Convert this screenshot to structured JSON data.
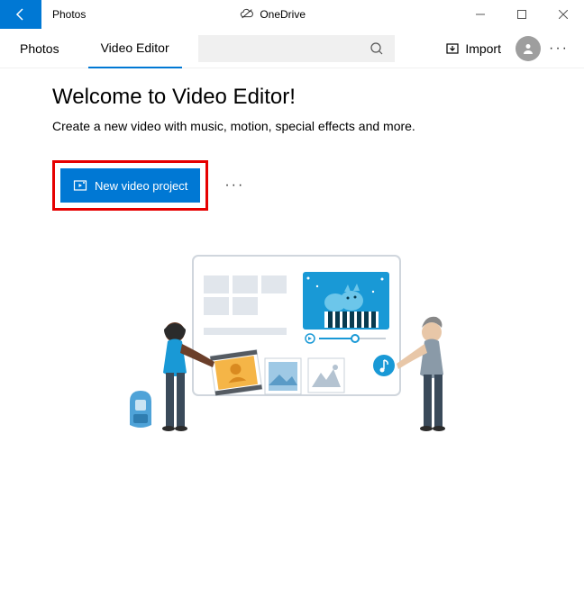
{
  "titlebar": {
    "app_title": "Photos",
    "onedrive_label": "OneDrive"
  },
  "toolbar": {
    "tabs": {
      "photos": "Photos",
      "video_editor": "Video Editor"
    },
    "import_label": "Import"
  },
  "content": {
    "heading": "Welcome to Video Editor!",
    "subheading": "Create a new video with music, motion, special effects and more.",
    "new_project_label": "New video project"
  }
}
